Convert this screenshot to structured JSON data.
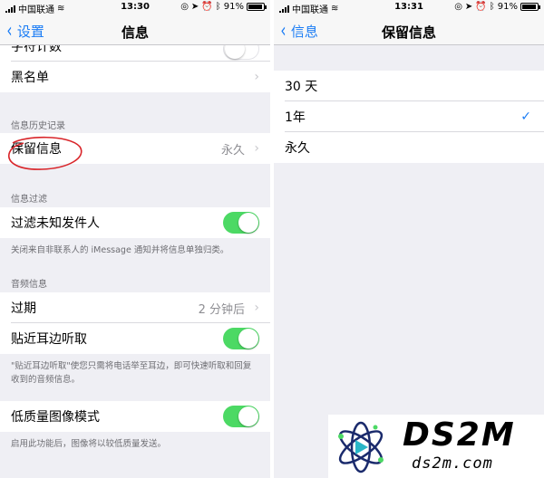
{
  "left": {
    "status": {
      "carrier": "中国联通",
      "time": "13:30",
      "battery": "91%",
      "battery_level": 0.91
    },
    "nav": {
      "back_label": "设置",
      "title": "信息"
    },
    "rows_top": [
      {
        "label": "字符计数"
      },
      {
        "label": "黑名单"
      }
    ],
    "history": {
      "header": "信息历史记录",
      "keep_label": "保留信息",
      "keep_value": "永久"
    },
    "filter": {
      "header": "信息过滤",
      "unknown_label": "过滤未知发件人",
      "footer": "关闭来自非联系人的 iMessage 通知并将信息单独归类。"
    },
    "audio": {
      "header": "音频信息",
      "expire_label": "过期",
      "expire_value": "2 分钟后",
      "raise_label": "贴近耳边听取",
      "footer": "\"贴近耳边听取\"使您只需将电话举至耳边，即可快速听取和回复收到的音频信息。"
    },
    "lowq": {
      "label": "低质量图像模式",
      "footer": "启用此功能后，图像将以较低质量发送。"
    }
  },
  "right": {
    "status": {
      "carrier": "中国联通",
      "time": "13:31",
      "battery": "91%",
      "battery_level": 0.91
    },
    "nav": {
      "back_label": "信息",
      "title": "保留信息"
    },
    "options": [
      {
        "label": "30 天",
        "selected": false
      },
      {
        "label": "1年",
        "selected": true
      },
      {
        "label": "永久",
        "selected": false
      }
    ],
    "checkmark": "✓"
  },
  "watermark": {
    "title": "DS2M",
    "subtitle": "ds2m.com"
  },
  "icons": {
    "chevron_left": "‹",
    "chevron_right": "›"
  },
  "colors": {
    "accent": "#1a7cf5",
    "toggle_on": "#4cd964",
    "annotation": "#d9252a"
  }
}
